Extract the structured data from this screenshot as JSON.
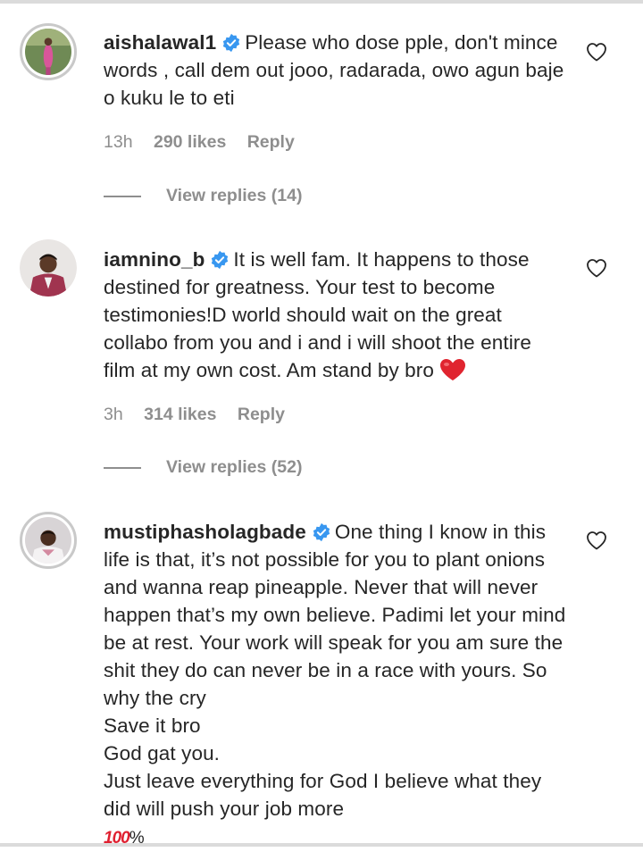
{
  "comments": [
    {
      "username": "aishalawal1",
      "text": "Please who dose pple, don't mince words , call dem out jooo, radarada, owo agun baje o kuku le to eti",
      "time": "13h",
      "likes": "290 likes",
      "reply": "Reply",
      "view_replies": "View replies (14)",
      "verified": true
    },
    {
      "username": "iamnino_b",
      "text": "It is well fam. It happens to those destined for greatness. Your test to become testimonies!D world should wait on the great collabo from you and i and i will shoot the entire film at my own cost. Am stand by bro",
      "emoji": "red-heart",
      "time": "3h",
      "likes": "314 likes",
      "reply": "Reply",
      "view_replies": "View replies (52)",
      "verified": true
    },
    {
      "username": "mustiphasholagbade",
      "text_lines": [
        "One thing I know in this life is that, it’s not possible for you to plant onions and wanna reap pineapple. Never that will never happen that’s my own believe. Padimi let your mind be at rest. Your work will speak for you am sure the shit they do can never be in a race with yours. So why the cry",
        "Save it bro",
        "God gat you.",
        "Just leave everything for God I believe what they did will push your job more"
      ],
      "hundred_emoji": "100",
      "hundred_suffix": "%",
      "verified": true
    }
  ],
  "colors": {
    "text": "#262626",
    "meta": "#8e8e8e",
    "verified": "#3897f0",
    "heart": "#ed4956"
  },
  "icons": [
    "verified-badge-icon",
    "heart-outline-icon",
    "red-heart-emoji",
    "hundred-points-emoji"
  ]
}
